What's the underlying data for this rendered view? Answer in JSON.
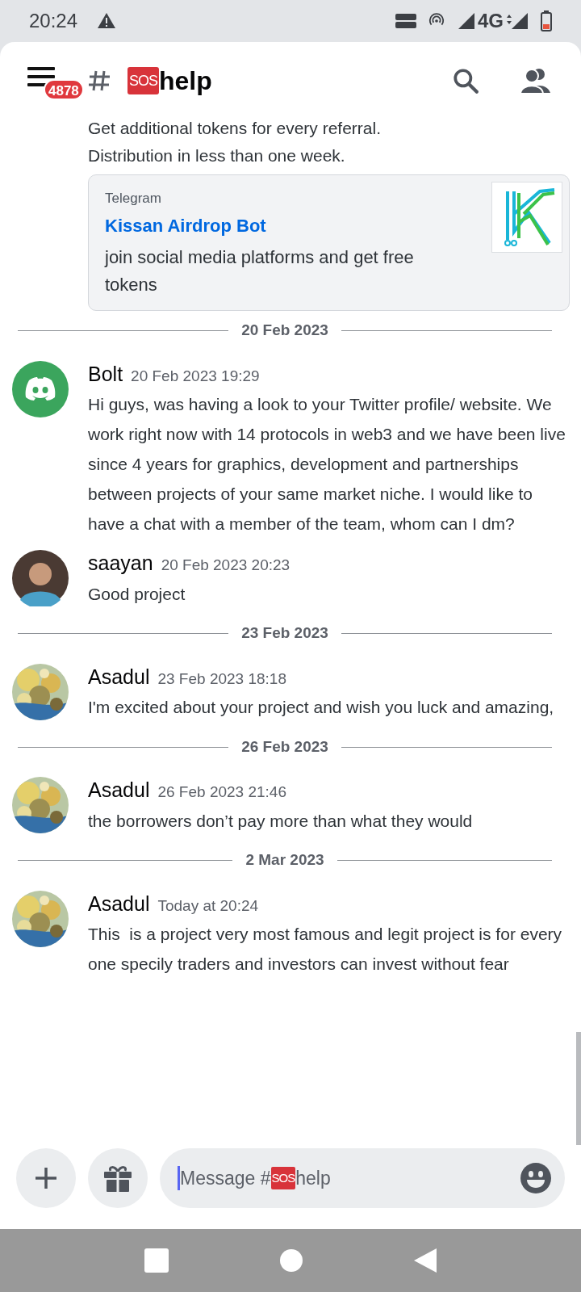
{
  "status_bar": {
    "time": "20:24",
    "network": "4G"
  },
  "header": {
    "unread_count": "4878",
    "channel_emoji": "SOS",
    "channel_name": "help"
  },
  "messages": [
    {
      "kind": "continuation",
      "lines": [
        "Get additional tokens for every referral.",
        "Distribution in less than one week."
      ],
      "embed": {
        "provider": "Telegram",
        "title": "Kissan Airdrop Bot",
        "description": "join social media platforms and get free tokens"
      }
    },
    {
      "kind": "divider",
      "date": "20 Feb 2023"
    },
    {
      "kind": "message",
      "avatar": {
        "kind": "discord"
      },
      "author": "Bolt",
      "timestamp": "20 Feb 2023 19:29",
      "text": "Hi guys, was having a look to your Twitter profile/ website. We work right now with 14 protocols in web3 and we have been live since 4 years for graphics, development and partnerships between projects of your same market niche. I would like to have a chat with a member of the team, whom can I dm?"
    },
    {
      "kind": "message",
      "avatar": {
        "kind": "person"
      },
      "author": "saayan",
      "timestamp": "20 Feb 2023 20:23",
      "text": "Good project"
    },
    {
      "kind": "divider",
      "date": "23 Feb 2023"
    },
    {
      "kind": "message",
      "author": "Asadul",
      "timestamp": "23 Feb 2023 18:18",
      "text": "I'm excited about your project and wish you luck and amazing,"
    },
    {
      "kind": "divider",
      "date": "26 Feb 2023"
    },
    {
      "kind": "message",
      "author": "Asadul",
      "timestamp": "26 Feb 2023 21:46",
      "text": "the borrowers don’t pay more than what they would"
    },
    {
      "kind": "divider",
      "date": "2 Mar 2023"
    },
    {
      "kind": "message",
      "author": "Asadul",
      "timestamp": "Today at 20:24",
      "text": "This  is a project very most famous and legit project is for every one specily traders and investors can invest without fear"
    }
  ],
  "composer": {
    "placeholder_prefix": "Message #",
    "channel_emoji": "SOS",
    "channel_name": "help"
  }
}
